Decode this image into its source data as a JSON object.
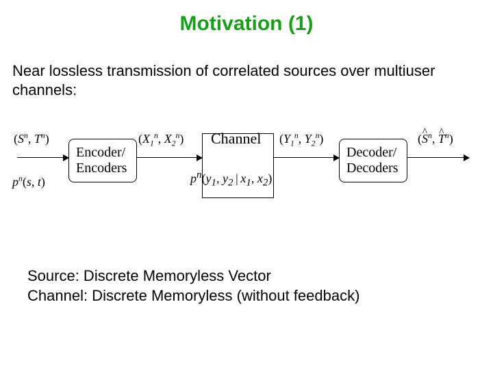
{
  "title": "Motivation (1)",
  "intro": "Near lossless transmission of correlated sources over multiuser channels:",
  "diagram": {
    "source_pair": "(Sⁿ, Tⁿ)",
    "source_dist": "pⁿ(s, t)",
    "encoder_l1": "Encoder/",
    "encoder_l2": "Encoders",
    "enc_out": "(X₁ⁿ, X₂ⁿ)",
    "channel_label": "Channel",
    "channel_dist": "pⁿ(y₁, y₂ | x₁, x₂)",
    "chan_out": "(Y₁ⁿ, Y₂ⁿ)",
    "decoder_l1": "Decoder/",
    "decoder_l2": "Decoders",
    "sink_pair": "(Ŝⁿ, T̂ⁿ)"
  },
  "footer_l1": "Source: Discrete Memoryless Vector",
  "footer_l2": "Channel: Discrete Memoryless (without feedback)"
}
